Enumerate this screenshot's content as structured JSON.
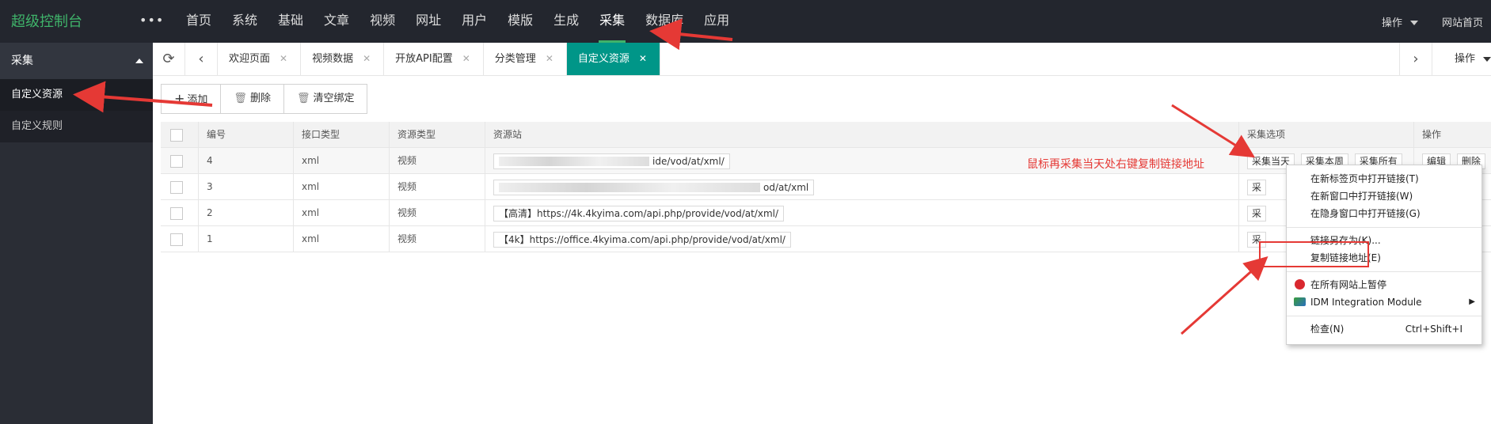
{
  "topbar": {
    "brand": "超级控制台",
    "more": "•••",
    "nav": [
      "首页",
      "系统",
      "基础",
      "文章",
      "视频",
      "网址",
      "用户",
      "模版",
      "生成",
      "采集",
      "数据库",
      "应用"
    ],
    "active_nav": "采集",
    "ops": "操作",
    "site_home": "网站首页"
  },
  "sidebar": {
    "header": "采集",
    "items": [
      "自定义资源",
      "自定义规则"
    ]
  },
  "tabs": {
    "items": [
      "欢迎页面",
      "视频数据",
      "开放API配置",
      "分类管理",
      "自定义资源"
    ],
    "close": "✕",
    "ops": "操作"
  },
  "toolbar": {
    "add": "添加",
    "delete": "删除",
    "clear": "清空绑定"
  },
  "table": {
    "headers": [
      "编号",
      "接口类型",
      "资源类型",
      "资源站",
      "采集选项",
      "操作"
    ],
    "rows": [
      {
        "id": "4",
        "api": "xml",
        "type": "视频",
        "url": "ide/vod/at/xml/",
        "opts": [
          "采集当天",
          "采集本周",
          "采集所有"
        ],
        "acts": [
          "编辑",
          "删除"
        ]
      },
      {
        "id": "3",
        "api": "xml",
        "type": "视频",
        "url": "od/at/xml",
        "opts": [
          "采"
        ],
        "acts": []
      },
      {
        "id": "2",
        "api": "xml",
        "type": "视频",
        "url": "【高清】https://4k.4kyima.com/api.php/provide/vod/at/xml/",
        "opts": [
          "采"
        ],
        "acts": []
      },
      {
        "id": "1",
        "api": "xml",
        "type": "视频",
        "url": "【4k】https://office.4kyima.com/api.php/provide/vod/at/xml/",
        "opts": [
          "采"
        ],
        "acts": []
      }
    ]
  },
  "annotation": "鼠标再采集当天处右键复制链接地址",
  "context_menu": {
    "open_new_tab": "在新标签页中打开链接(T)",
    "open_new_window": "在新窗口中打开链接(W)",
    "open_incognito": "在隐身窗口中打开链接(G)",
    "save_link": "链接另存为(K)...",
    "copy_link": "复制链接地址(E)",
    "pause_all": "在所有网站上暂停",
    "idm": "IDM Integration Module",
    "inspect": "检查(N)",
    "inspect_shortcut": "Ctrl+Shift+I"
  },
  "colors": {
    "accent": "#009688",
    "brand": "#3fb36a",
    "annotation": "#e53935",
    "topbar": "#23262e",
    "sidebar": "#2a2d35"
  }
}
